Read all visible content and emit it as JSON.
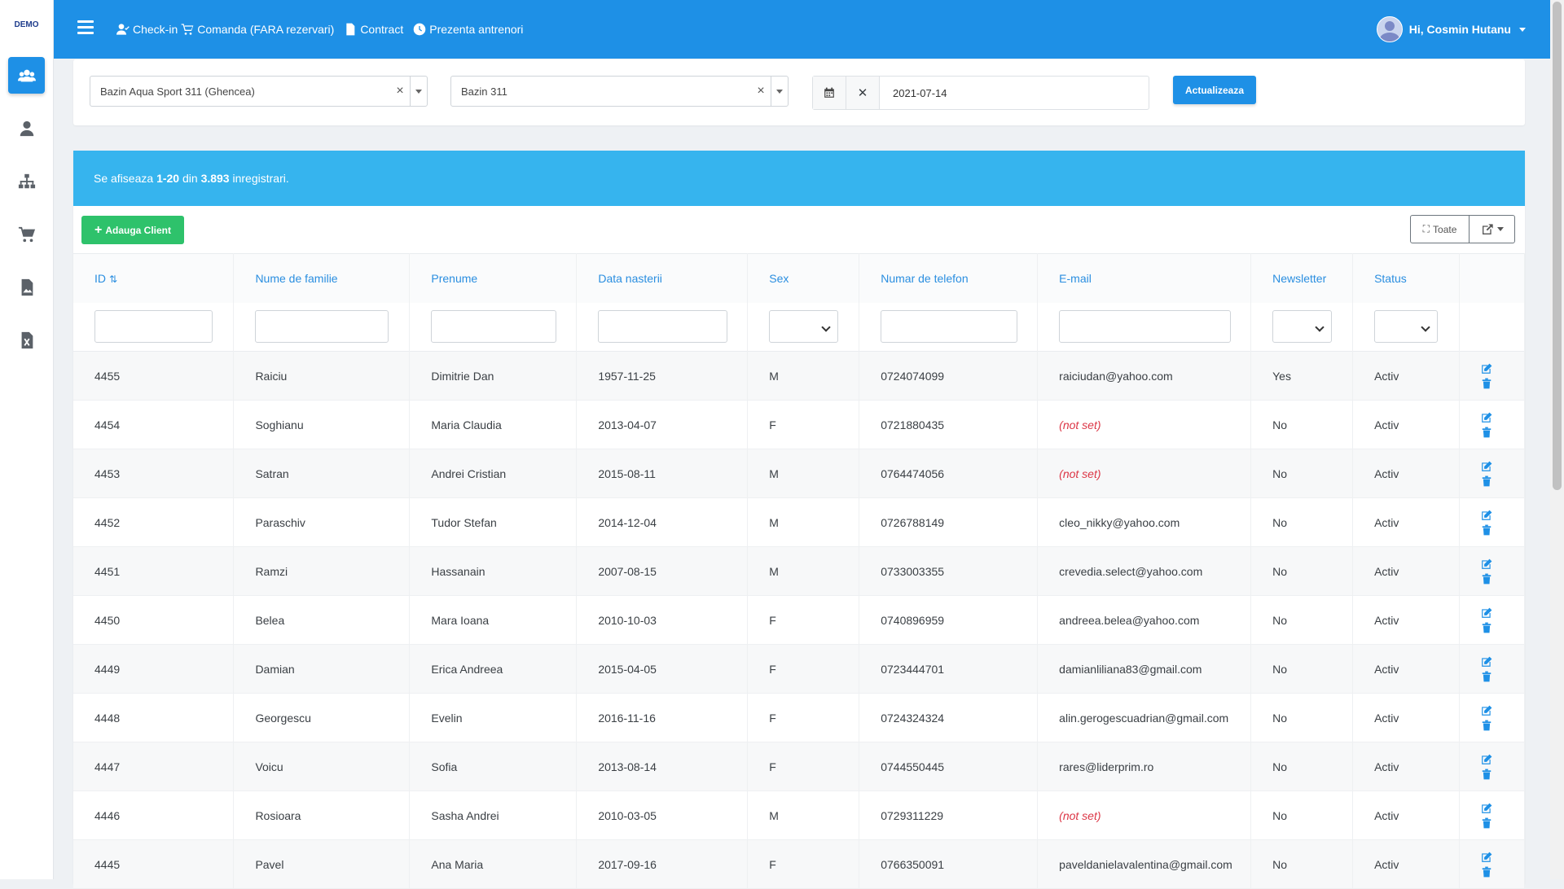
{
  "sidebar": {
    "logo": "DEMO",
    "items": [
      {
        "icon": "users-icon"
      },
      {
        "icon": "user-tie-icon"
      },
      {
        "icon": "sitemap-icon"
      },
      {
        "icon": "cart-icon"
      },
      {
        "icon": "file-image-icon"
      },
      {
        "icon": "file-excel-icon"
      }
    ],
    "active_index": 0
  },
  "topbar": {
    "nav": [
      {
        "label": "Check-in",
        "icon": "user-check-icon"
      },
      {
        "label": "Comanda (FARA rezervari)",
        "icon": "cart-icon"
      },
      {
        "label": "Contract",
        "icon": "file-icon"
      },
      {
        "label": "Prezenta antrenori",
        "icon": "clock-icon"
      }
    ],
    "user_greeting": "Hi, Cosmin Hutanu"
  },
  "filters": {
    "location": "Bazin Aqua Sport 311 (Ghencea)",
    "facility": "Bazin 311",
    "date": "2021-07-14",
    "update_label": "Actualizeaza"
  },
  "summary": {
    "prefix": "Se afiseaza ",
    "range": "1-20",
    "mid": " din ",
    "total": "3.893",
    "suffix": " inregistrari."
  },
  "toolbar": {
    "add_label": "Adauga Client",
    "toggle_label": "Toate"
  },
  "table": {
    "columns": [
      "ID",
      "Nume de familie",
      "Prenume",
      "Data nasterii",
      "Sex",
      "Numar de telefon",
      "E-mail",
      "Newsletter",
      "Status"
    ],
    "rows": [
      [
        "4455",
        "Raiciu",
        "Dimitrie Dan",
        "1957-11-25",
        "M",
        "0724074099",
        "raiciudan@yahoo.com",
        "Yes",
        "Activ"
      ],
      [
        "4454",
        "Soghianu",
        "Maria Claudia",
        "2013-04-07",
        "F",
        "0721880435",
        "(not set)",
        "No",
        "Activ"
      ],
      [
        "4453",
        "Satran",
        "Andrei Cristian",
        "2015-08-11",
        "M",
        "0764474056",
        "(not set)",
        "No",
        "Activ"
      ],
      [
        "4452",
        "Paraschiv",
        "Tudor Stefan",
        "2014-12-04",
        "M",
        "0726788149",
        "cleo_nikky@yahoo.com",
        "No",
        "Activ"
      ],
      [
        "4451",
        "Ramzi",
        "Hassanain",
        "2007-08-15",
        "M",
        "0733003355",
        "crevedia.select@yahoo.com",
        "No",
        "Activ"
      ],
      [
        "4450",
        "Belea",
        "Mara Ioana",
        "2010-10-03",
        "F",
        "0740896959",
        "andreea.belea@yahoo.com",
        "No",
        "Activ"
      ],
      [
        "4449",
        "Damian",
        "Erica Andreea",
        "2015-04-05",
        "F",
        "0723444701",
        "damianliliana83@gmail.com",
        "No",
        "Activ"
      ],
      [
        "4448",
        "Georgescu",
        "Evelin",
        "2016-11-16",
        "F",
        "0724324324",
        "alin.gerogescuadrian@gmail.com",
        "No",
        "Activ"
      ],
      [
        "4447",
        "Voicu",
        "Sofia",
        "2013-08-14",
        "F",
        "0744550445",
        "rares@liderprim.ro",
        "No",
        "Activ"
      ],
      [
        "4446",
        "Rosioara",
        "Sasha Andrei",
        "2010-03-05",
        "M",
        "0729311229",
        "(not set)",
        "No",
        "Activ"
      ],
      [
        "4445",
        "Pavel",
        "Ana Maria",
        "2017-09-16",
        "F",
        "0766350091",
        "paveldanielavalentina@gmail.com",
        "No",
        "Activ"
      ]
    ]
  },
  "colors": {
    "primary": "#1e90e6",
    "info": "#36b4ee",
    "success": "#2ec26b",
    "danger": "#dc3545"
  }
}
